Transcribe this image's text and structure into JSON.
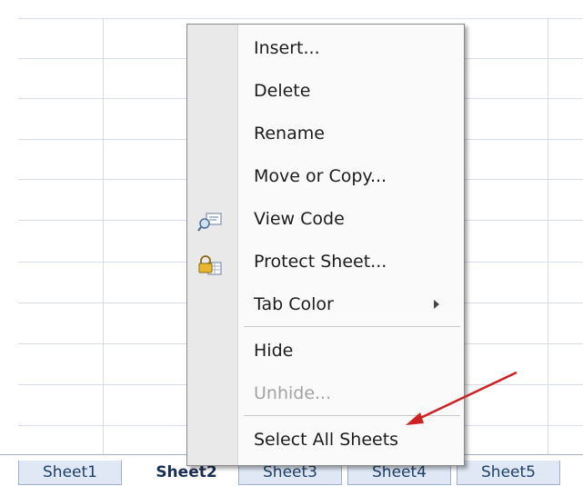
{
  "context_menu": {
    "items": [
      {
        "label": "Insert...",
        "enabled": true
      },
      {
        "label": "Delete",
        "enabled": true
      },
      {
        "label": "Rename",
        "enabled": true
      },
      {
        "label": "Move or Copy...",
        "enabled": true
      },
      {
        "label": "View Code",
        "enabled": true,
        "icon": "view-code-icon"
      },
      {
        "label": "Protect Sheet...",
        "enabled": true,
        "icon": "protect-sheet-icon"
      },
      {
        "label": "Tab Color",
        "enabled": true,
        "submenu": true
      },
      {
        "label": "Hide",
        "enabled": true
      },
      {
        "label": "Unhide...",
        "enabled": false
      },
      {
        "label": "Select All Sheets",
        "enabled": true
      }
    ]
  },
  "sheet_tabs": [
    {
      "label": "Sheet1",
      "active": false
    },
    {
      "label": "Sheet2",
      "active": true
    },
    {
      "label": "Sheet3",
      "active": false
    },
    {
      "label": "Sheet4",
      "active": false
    },
    {
      "label": "Sheet5",
      "active": false
    }
  ],
  "colors": {
    "arrow": "#cc2222",
    "tab_text": "#1f3f6b",
    "grid": "#d6dde8"
  }
}
